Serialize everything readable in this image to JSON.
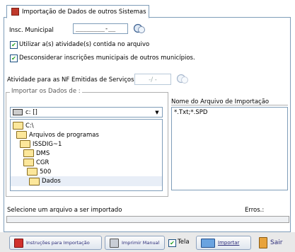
{
  "tab": {
    "label": "Importação de Dados de outros Sistemas"
  },
  "inscricao": {
    "label": "Insc. Municipal",
    "value": "________-__"
  },
  "options": {
    "utilizar_label": "Utilizar a(s) atividade(s) contida no arquivo",
    "desconsiderar_label": "Desconsiderar inscrições municipais de outros municípios."
  },
  "atividade": {
    "label": "Atividade para as NF Emitidas de Serviços",
    "value": "  -/  -"
  },
  "import_group": {
    "title": "Importar os Dados de :",
    "drive": "c: []",
    "dirs": [
      "C:\\",
      "Arquivos de programas",
      "ISSDIG~1",
      "DMS",
      "CGR",
      "500",
      "Dados"
    ],
    "filename_header": "Nome do Arquivo de Importação",
    "filter": "*.Txt;*.SPD"
  },
  "status": {
    "message": "Selecione um arquivo a ser importado",
    "erros_label": "Erros.:"
  },
  "buttons": {
    "instrucoes": "Instruções para Importação",
    "imprimir": "Imprimir Manual",
    "tela": "Tela",
    "importar": "Importar",
    "sair": "Sair"
  },
  "colors": {
    "accent_border": "#7f9db9",
    "selection": "#e8eef7",
    "folder": "#f6d66f"
  },
  "icons": [
    "document-icon",
    "search-icon",
    "drive-icon",
    "folder-icon",
    "open-folder-icon",
    "book-icon",
    "printer-icon",
    "import-icon",
    "exit-door-icon"
  ]
}
